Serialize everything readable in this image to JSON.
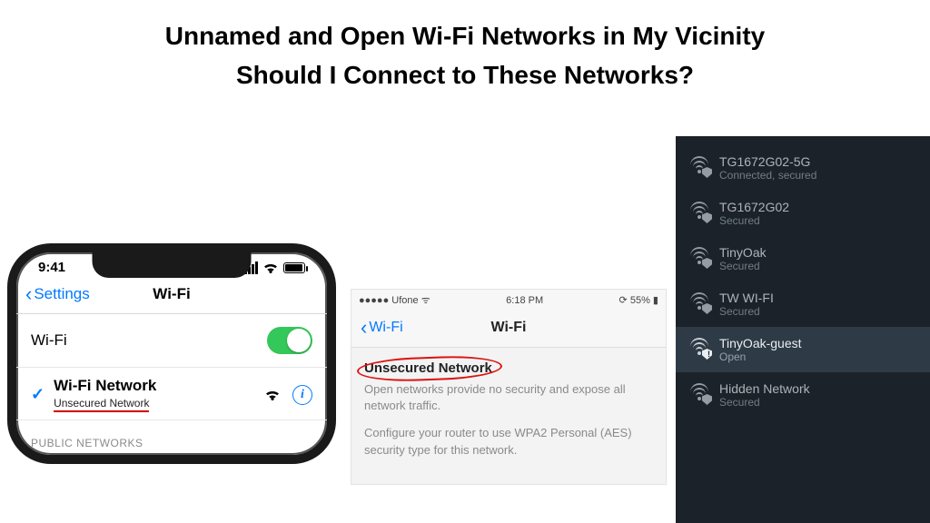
{
  "heading": {
    "line1": "Unnamed and Open Wi-Fi Networks in My Vicinity",
    "line2": "Should I Connect to These Networks?"
  },
  "iphone": {
    "status_time": "9:41",
    "back_label": "Settings",
    "nav_title": "Wi-Fi",
    "wifi_row_label": "Wi-Fi",
    "wifi_toggle_on": true,
    "connected_name": "Wi-Fi Network",
    "connected_sub": "Unsecured Network",
    "section_public": "PUBLIC NETWORKS"
  },
  "midpanel": {
    "carrier": "Ufone",
    "time": "6:18 PM",
    "battery_pct": "55%",
    "back_label": "Wi-Fi",
    "nav_title": "Wi-Fi",
    "header": "Unsecured Network",
    "p1": "Open networks provide no security and expose all network traffic.",
    "p2": "Configure your router to use WPA2 Personal (AES) security type for this network."
  },
  "windows": {
    "items": [
      {
        "name": "TG1672G02-5G",
        "sub": "Connected, secured",
        "secured": true,
        "selected": false
      },
      {
        "name": "TG1672G02",
        "sub": "Secured",
        "secured": true,
        "selected": false
      },
      {
        "name": "TinyOak",
        "sub": "Secured",
        "secured": true,
        "selected": false
      },
      {
        "name": "TW WI-FI",
        "sub": "Secured",
        "secured": true,
        "selected": false
      },
      {
        "name": "TinyOak-guest",
        "sub": "Open",
        "secured": false,
        "selected": true
      },
      {
        "name": "Hidden Network",
        "sub": "Secured",
        "secured": true,
        "selected": false
      }
    ]
  }
}
